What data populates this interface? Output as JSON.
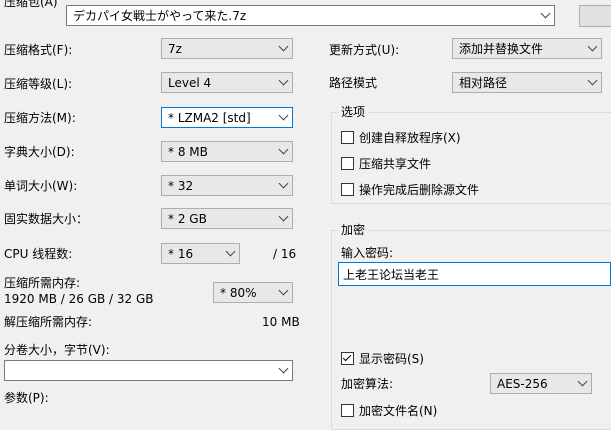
{
  "archive": {
    "label": "压缩包(A)",
    "path": "デカパイ女戦士がやって来た.7z"
  },
  "left": {
    "format_label": "压缩格式(F):",
    "format_value": "7z",
    "level_label": "压缩等级(L):",
    "level_value": "Level 4",
    "method_label": "压缩方法(M):",
    "method_value": "*  LZMA2 [std]",
    "dict_label": "字典大小(D):",
    "dict_value": "*  8 MB",
    "word_label": "单词大小(W):",
    "word_value": "*  32",
    "solid_label": "固实数据大小：",
    "solid_value": "*  2 GB",
    "cpu_label": "CPU 线程数:",
    "cpu_value": "*  16",
    "cpu_total": "/ 16",
    "mem_label": "压缩所需内存:",
    "mem_detail": "1920 MB / 26 GB / 32 GB",
    "mem_value": "*  80%",
    "decomp_label": "解压缩所需内存:",
    "decomp_value": "10 MB",
    "split_label": "分卷大小，字节(V):",
    "split_value": "",
    "params_label": "参数(P):"
  },
  "right": {
    "update_label": "更新方式(U):",
    "update_value": "添加并替换文件",
    "path_label": "路径模式",
    "path_value": "相对路径",
    "options_title": "选项",
    "opt_sfx": "创建自释放程序(X)",
    "opt_shared": "压缩共享文件",
    "opt_delete": "操作完成后删除源文件",
    "encrypt_title": "加密",
    "password_label": "输入密码:",
    "password_value": "上老王论坛当老王",
    "show_password": "显示密码(S)",
    "enc_method_label": "加密算法:",
    "enc_method_value": "AES-256",
    "encrypt_names": "加密文件名(N)"
  },
  "checks": {
    "sfx": false,
    "shared": false,
    "delete": false,
    "show_password": true,
    "encrypt_names": false
  }
}
